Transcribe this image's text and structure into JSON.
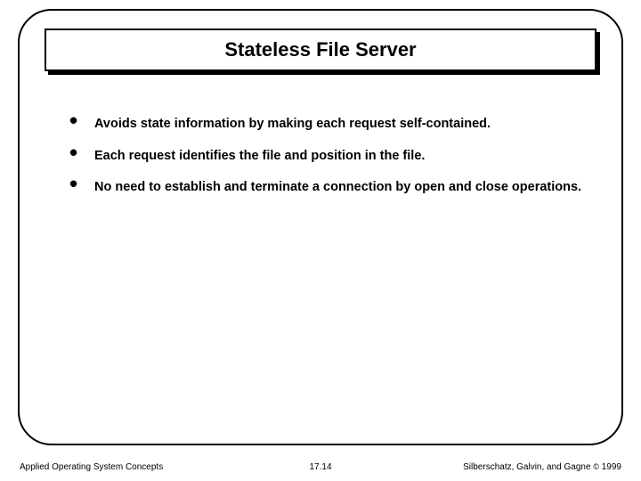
{
  "title": "Stateless File Server",
  "bullets": [
    "Avoids state information by making each request self-contained.",
    "Each request identifies the file and position in the file.",
    "No need to establish and terminate a connection by open and close operations."
  ],
  "footer": {
    "left": "Applied Operating System Concepts",
    "center": "17.14",
    "right_prefix": "Silberschatz, Galvin, and Gagne ",
    "right_mark": "©",
    "right_suffix": " 1999"
  }
}
